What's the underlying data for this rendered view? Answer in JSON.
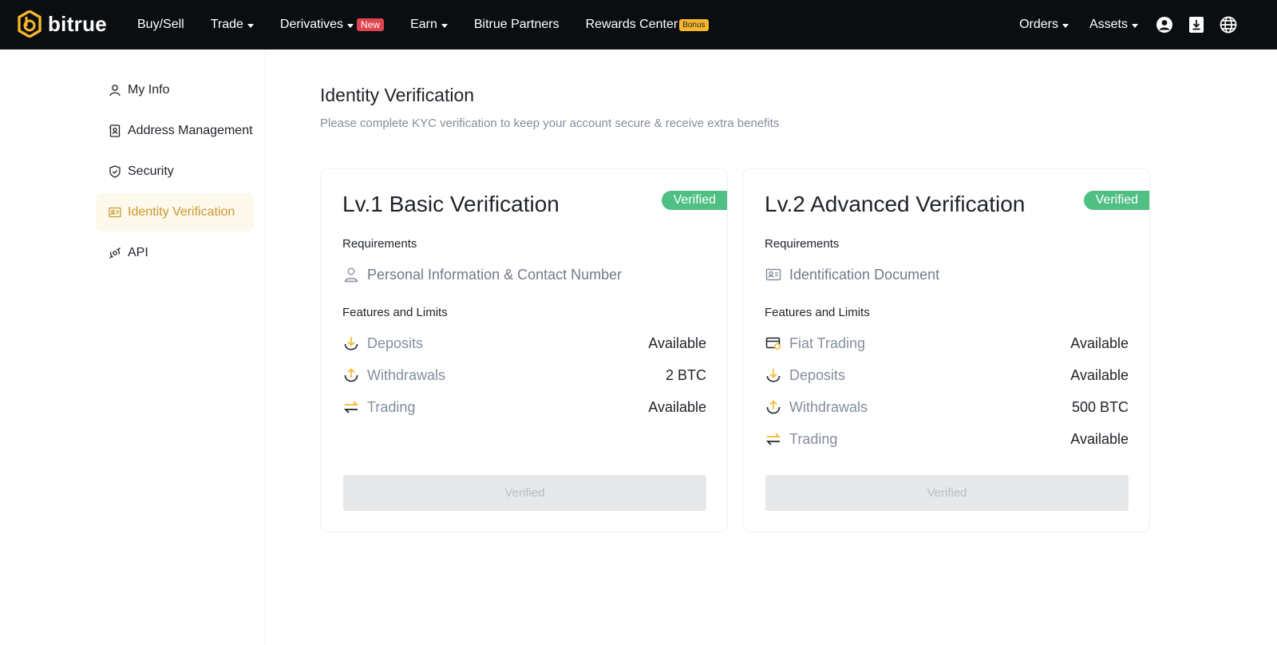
{
  "brand": {
    "name": "bitrue"
  },
  "nav": {
    "items": [
      {
        "label": "Buy/Sell"
      },
      {
        "label": "Trade"
      },
      {
        "label": "Derivatives",
        "badge": "New"
      },
      {
        "label": "Earn"
      },
      {
        "label": "Bitrue Partners"
      },
      {
        "label": "Rewards Center",
        "badge": "Bonus"
      }
    ],
    "right": [
      {
        "label": "Orders"
      },
      {
        "label": "Assets"
      }
    ],
    "icons": [
      "user-icon",
      "download-icon",
      "globe-icon"
    ]
  },
  "sidebar": {
    "items": [
      {
        "label": "My Info",
        "icon": "user-icon"
      },
      {
        "label": "Address Management",
        "icon": "address-book-icon"
      },
      {
        "label": "Security",
        "icon": "shield-icon"
      },
      {
        "label": "Identity Verification",
        "icon": "id-card-icon",
        "active": true
      },
      {
        "label": "API",
        "icon": "api-icon"
      }
    ]
  },
  "page": {
    "title": "Identity Verification",
    "subtitle": "Please complete KYC verification to keep your account secure & receive extra benefits"
  },
  "cards": [
    {
      "title": "Lv.1 Basic Verification",
      "status": "Verified",
      "requirements_label": "Requirements",
      "requirement": "Personal Information & Contact Number",
      "features_label": "Features and Limits",
      "features": [
        {
          "name": "Deposits",
          "value": "Available"
        },
        {
          "name": "Withdrawals",
          "value": "2 BTC"
        },
        {
          "name": "Trading",
          "value": "Available"
        }
      ],
      "button": "Verified"
    },
    {
      "title": "Lv.2 Advanced Verification",
      "status": "Verified",
      "requirements_label": "Requirements",
      "requirement": "Identification Document",
      "features_label": "Features and Limits",
      "features": [
        {
          "name": "Fiat Trading",
          "value": "Available"
        },
        {
          "name": "Deposits",
          "value": "Available"
        },
        {
          "name": "Withdrawals",
          "value": "500 BTC"
        },
        {
          "name": "Trading",
          "value": "Available"
        }
      ],
      "button": "Verified"
    }
  ],
  "colors": {
    "accent": "#f5b62b",
    "verified": "#4fbf83",
    "new_badge": "#e0454f",
    "nav_bg": "#0b0e11"
  }
}
